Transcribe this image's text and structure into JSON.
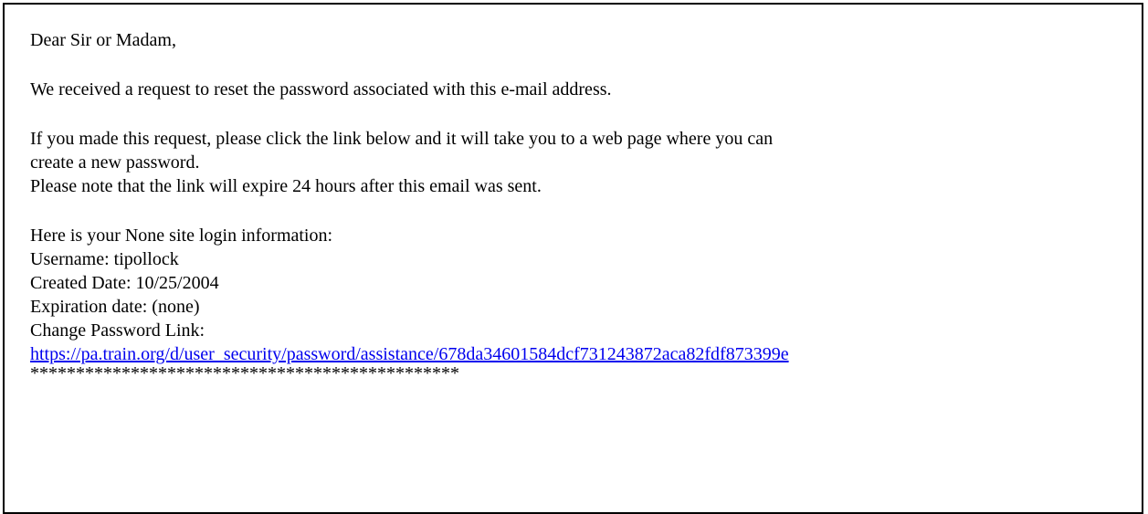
{
  "email": {
    "greeting": "Dear Sir or Madam,",
    "paragraph1": "We received a request to reset the password associated with this e-mail address.",
    "paragraph2_line1": "If you made this request, please click the link below and it will take you to a web page where you can",
    "paragraph2_line2": "create a new password.",
    "paragraph2_line3": "Please note that the link will expire 24 hours after this email was sent.",
    "login_intro": "Here is your None site login information:",
    "username_line": "Username: tipollock",
    "created_date_line": "Created Date: 10/25/2004",
    "expiration_date_line": "Expiration date: (none)",
    "change_password_label": "Change Password Link:",
    "change_password_link": "https://pa.train.org/d/user_security/password/assistance/678da34601584dcf731243872aca82fdf873399e",
    "separator": "***********************************************"
  },
  "colors": {
    "text": "#000000",
    "link": "#0000ee",
    "border": "#000000",
    "background": "#ffffff"
  }
}
